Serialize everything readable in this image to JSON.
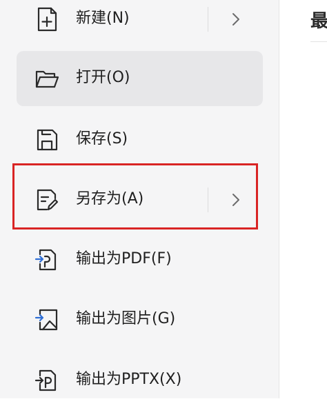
{
  "menu": {
    "items": [
      {
        "label": "新建(N)",
        "icon": "new-file-icon",
        "has_submenu": true
      },
      {
        "label": "打开(O)",
        "icon": "folder-open-icon",
        "has_submenu": false,
        "active": true
      },
      {
        "label": "保存(S)",
        "icon": "save-icon",
        "has_submenu": false
      },
      {
        "label": "另存为(A)",
        "icon": "save-as-icon",
        "has_submenu": true,
        "highlighted": true
      },
      {
        "label": "输出为PDF(F)",
        "icon": "export-pdf-icon",
        "has_submenu": false
      },
      {
        "label": "输出为图片(G)",
        "icon": "export-image-icon",
        "has_submenu": false
      },
      {
        "label": "输出为PPTX(X)",
        "icon": "export-pptx-icon",
        "has_submenu": false
      }
    ]
  },
  "right_pane": {
    "title_partial": "最"
  },
  "colors": {
    "panel_bg": "#f5f5f6",
    "active_bg": "#e7e7e9",
    "highlight_border": "#d92424",
    "accent_blue": "#2f6fd6"
  }
}
